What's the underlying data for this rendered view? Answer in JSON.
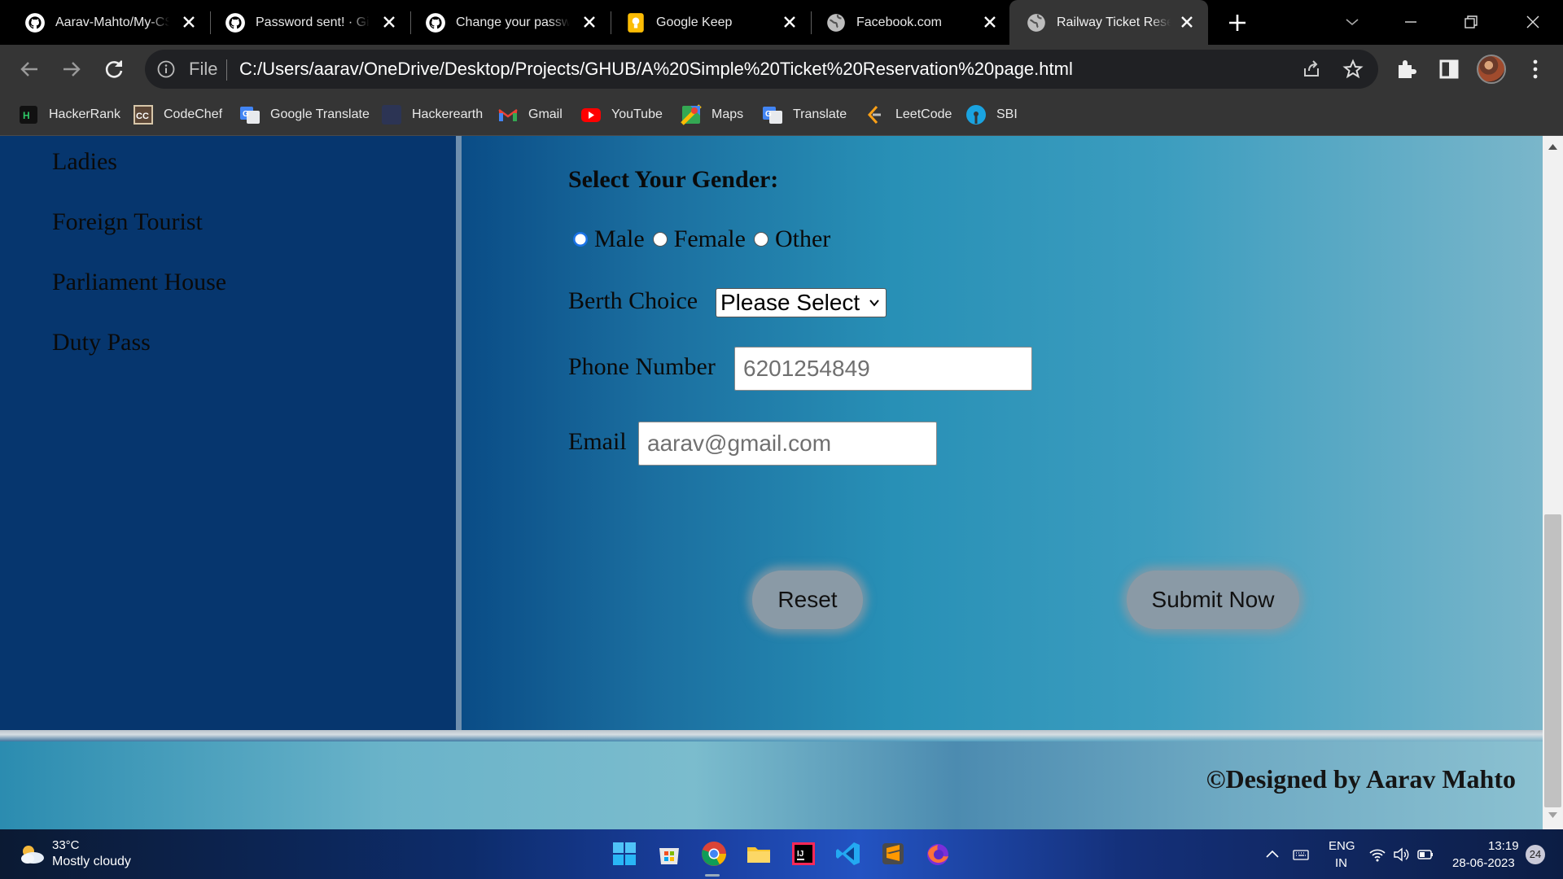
{
  "browser": {
    "tabs": [
      {
        "title": "Aarav-Mahto/My-CSS",
        "icon": "github-icon"
      },
      {
        "title": "Password sent! · GitHub",
        "icon": "github-icon"
      },
      {
        "title": "Change your password",
        "icon": "github-icon"
      },
      {
        "title": "Google Keep",
        "icon": "google-keep-icon"
      },
      {
        "title": "Facebook.com",
        "icon": "globe-icon"
      },
      {
        "title": "Railway Ticket Reservation",
        "icon": "globe-icon",
        "active": true
      }
    ],
    "address": {
      "scheme": "File",
      "url": "C:/Users/aarav/OneDrive/Desktop/Projects/GHUB/A%20Simple%20Ticket%20Reservation%20page.html"
    },
    "bookmarks": [
      {
        "label": "HackerRank",
        "icon": "hackerrank-icon"
      },
      {
        "label": "CodeChef",
        "icon": "codechef-icon"
      },
      {
        "label": "Google Translate",
        "icon": "google-translate-icon"
      },
      {
        "label": "Hackerearth",
        "icon": "hackerearth-icon"
      },
      {
        "label": "Gmail",
        "icon": "gmail-icon"
      },
      {
        "label": "YouTube",
        "icon": "youtube-icon"
      },
      {
        "label": "Maps",
        "icon": "maps-icon"
      },
      {
        "label": "Translate",
        "icon": "translate-icon"
      },
      {
        "label": "LeetCode",
        "icon": "leetcode-icon"
      },
      {
        "label": "SBI",
        "icon": "sbi-icon"
      }
    ]
  },
  "sidebar": {
    "items": [
      "Ladies",
      "Foreign Tourist",
      "Parliament House",
      "Duty Pass"
    ]
  },
  "form": {
    "gender_title": "Select Your Gender:",
    "gender_options": [
      {
        "label": "Male",
        "checked": true
      },
      {
        "label": "Female",
        "checked": false
      },
      {
        "label": "Other",
        "checked": false
      }
    ],
    "berth_label": "Berth Choice",
    "berth_value": "Please Select",
    "phone_label": "Phone Number",
    "phone_value": "6201254849",
    "email_label": "Email",
    "email_value": "aarav@gmail.com",
    "reset_label": "Reset",
    "submit_label": "Submit Now"
  },
  "footer": {
    "text": "©Designed by Aarav Mahto"
  },
  "taskbar": {
    "weather_temp": "33°C",
    "weather_desc": "Mostly cloudy",
    "language_line1": "ENG",
    "language_line2": "IN",
    "time": "13:19",
    "date": "28-06-2023",
    "notifications": "24"
  },
  "colors": {
    "sidebar_bg": "#06366e",
    "form_gradient_start": "#0a4c86",
    "form_gradient_end": "#7ab6ca",
    "button_bg": "#8a9aa6",
    "radio_accent": "#1a73e8"
  }
}
